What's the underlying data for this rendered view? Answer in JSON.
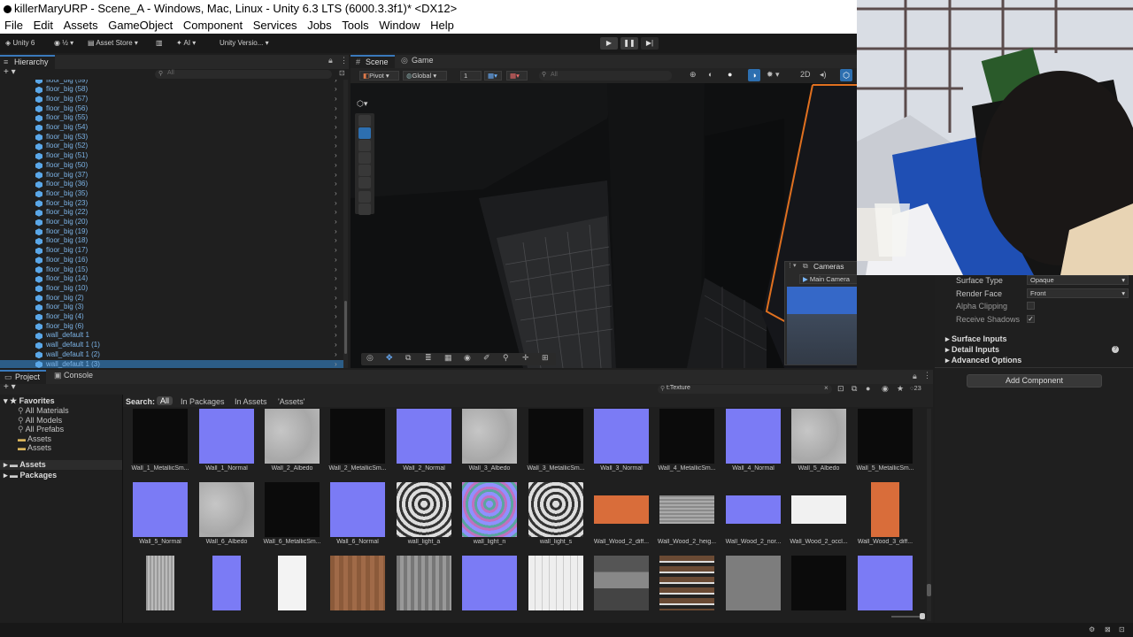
{
  "window": {
    "title": "killerMaryURP - Scene_A - Windows, Mac, Linux - Unity 6.3 LTS (6000.3.3f1)* <DX12>"
  },
  "menu": [
    "File",
    "Edit",
    "Assets",
    "GameObject",
    "Component",
    "Services",
    "Jobs",
    "Tools",
    "Window",
    "Help"
  ],
  "toolbar": {
    "unity_label": "Unity 6",
    "asset_store": "Asset Store",
    "ai": "AI",
    "version_control": "Unity Versio..."
  },
  "hierarchy": {
    "tab": "Hierarchy",
    "search_placeholder": "All",
    "items": [
      "floor_big (59)",
      "floor_big (58)",
      "floor_big (57)",
      "floor_big (56)",
      "floor_big (55)",
      "floor_big (54)",
      "floor_big (53)",
      "floor_big (52)",
      "floor_big (51)",
      "floor_big (50)",
      "floor_big (37)",
      "floor_big (36)",
      "floor_big (35)",
      "floor_big (23)",
      "floor_big (22)",
      "floor_big (20)",
      "floor_big (19)",
      "floor_big (18)",
      "floor_big (17)",
      "floor_big (16)",
      "floor_big (15)",
      "floor_big (14)",
      "floor_big (10)",
      "floor_big (2)",
      "floor_big (3)",
      "floor_big (4)",
      "floor_big (6)",
      "wall_default 1",
      "wall_default 1 (1)",
      "wall_default 1 (2)",
      "wall_default 1 (3)"
    ]
  },
  "scene": {
    "tabs": [
      "Scene",
      "Game"
    ],
    "pivot": "Pivot",
    "global": "Global",
    "grid_snap": "1",
    "search_placeholder": "All",
    "cameras_overlay": {
      "title": "Cameras",
      "camera": "Main Camera"
    }
  },
  "inspector": {
    "rows": [
      {
        "label": "Surface Type",
        "value": "Opaque"
      },
      {
        "label": "Render Face",
        "value": "Front"
      }
    ],
    "checks": [
      {
        "label": "Alpha Clipping",
        "checked": false
      },
      {
        "label": "Receive Shadows",
        "checked": true
      }
    ],
    "sections": [
      "Surface Inputs",
      "Detail Inputs",
      "Advanced Options"
    ],
    "add_component": "Add Component"
  },
  "project": {
    "tabs": [
      "Project",
      "Console"
    ],
    "search_value": "t:Texture",
    "hidden_count": "23",
    "favorites_label": "Favorites",
    "favorites": [
      "All Materials",
      "All Models",
      "All Prefabs",
      "Assets",
      "Assets"
    ],
    "roots": [
      "Assets",
      "Packages"
    ],
    "search_label": "Search:",
    "scopes": [
      "All",
      "In Packages",
      "In Assets",
      "'Assets'"
    ],
    "row1": [
      {
        "name": "Wall_1_MetallicSm...",
        "tex": "black"
      },
      {
        "name": "Wall_1_Normal",
        "tex": "normal"
      },
      {
        "name": "Wall_2_Albedo",
        "tex": "gray"
      },
      {
        "name": "Wall_2_MetallicSm...",
        "tex": "black"
      },
      {
        "name": "Wall_2_Normal",
        "tex": "normal"
      },
      {
        "name": "Wall_3_Albedo",
        "tex": "gray"
      },
      {
        "name": "Wall_3_MetallicSm...",
        "tex": "black"
      },
      {
        "name": "Wall_3_Normal",
        "tex": "normal"
      },
      {
        "name": "Wall_4_MetallicSm...",
        "tex": "black"
      },
      {
        "name": "Wall_4_Normal",
        "tex": "normal"
      },
      {
        "name": "Wall_5_Albedo",
        "tex": "gray"
      },
      {
        "name": "Wall_5_MetallicSm...",
        "tex": "black"
      }
    ],
    "row2": [
      {
        "name": "Wall_5_Normal",
        "tex": "normal"
      },
      {
        "name": "Wall_6_Albedo",
        "tex": "gray"
      },
      {
        "name": "Wall_6_MetallicSm...",
        "tex": "black"
      },
      {
        "name": "Wall_6_Normal",
        "tex": "normal"
      },
      {
        "name": "wall_light_a",
        "tex": "light"
      },
      {
        "name": "wall_light_n",
        "tex": "lightn"
      },
      {
        "name": "wall_light_s",
        "tex": "light"
      },
      {
        "name": "Wall_Wood_2_diff...",
        "tex": "wood"
      },
      {
        "name": "Wall_Wood_2_heig...",
        "tex": "woodgray"
      },
      {
        "name": "Wall_Wood_2_nor...",
        "tex": "normalflat"
      },
      {
        "name": "Wall_Wood_2_occl...",
        "tex": "white"
      },
      {
        "name": "Wall_Wood_3_diff...",
        "tex": "woodtall"
      }
    ],
    "row3": [
      {
        "tex": "graytall"
      },
      {
        "tex": "normaltall"
      },
      {
        "tex": "whitetall"
      },
      {
        "tex": "brown"
      },
      {
        "tex": "grayplank"
      },
      {
        "tex": "normal"
      },
      {
        "tex": "whiteplank"
      },
      {
        "tex": "atlas"
      },
      {
        "tex": "atlas2"
      },
      {
        "tex": "midgray"
      },
      {
        "tex": "black"
      },
      {
        "tex": "normal"
      }
    ]
  },
  "colors": {
    "selection": "#2c5d87",
    "accent_orange": "#e0701f",
    "normal_map": "#7b7bf5",
    "hierarchy_text": "#7cb3e6"
  }
}
